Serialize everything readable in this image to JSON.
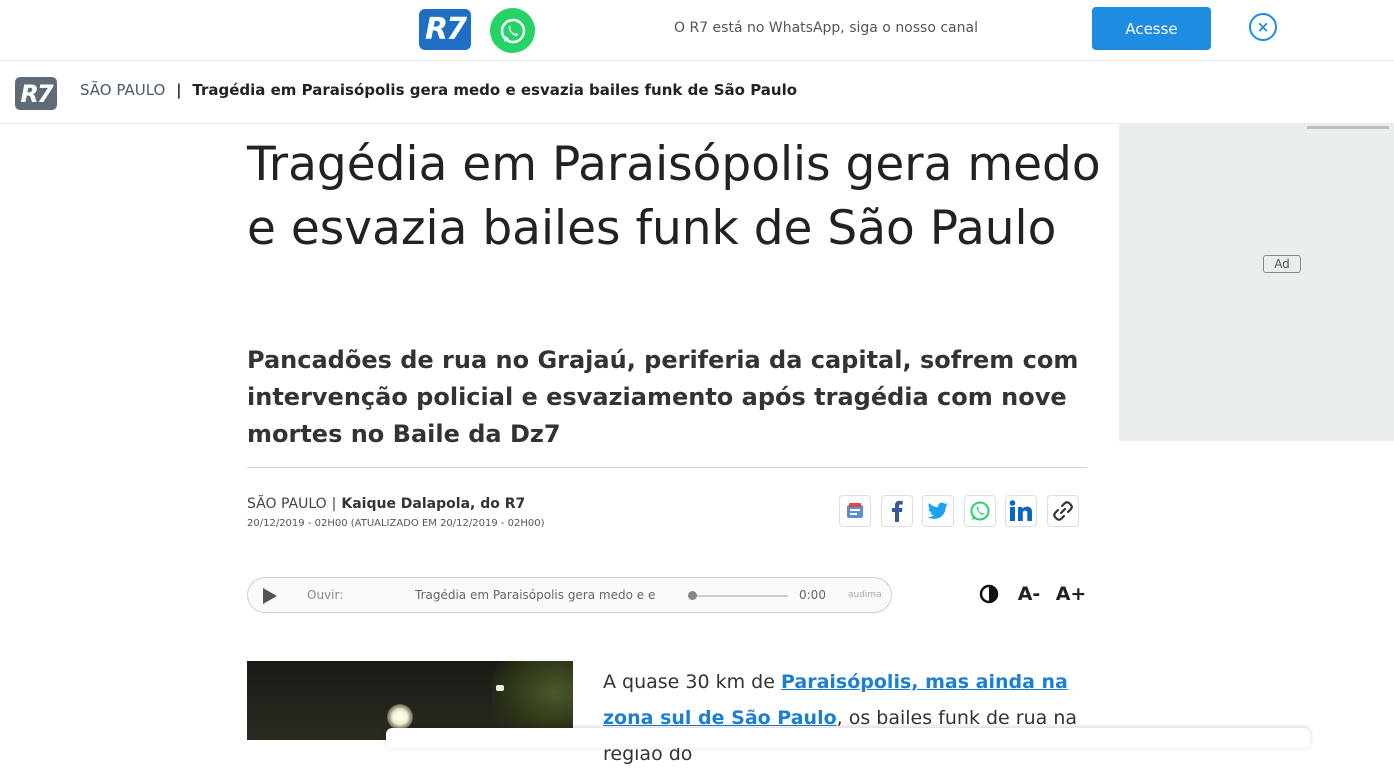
{
  "promo": {
    "logo_text": "R7",
    "whatsapp_icon": "whatsapp-icon",
    "text": "O R7 está no WhatsApp, siga o nosso canal",
    "button_label": "Acesse",
    "close_glyph": "×"
  },
  "nav": {
    "logo_text": "R7",
    "section": "SÃO PAULO",
    "separator": "|",
    "title": "Tragédia em Paraisópolis gera medo e esvazia bailes funk de São Paulo"
  },
  "ad": {
    "label": "Ad"
  },
  "article": {
    "headline": "Tragédia em Paraisópolis gera medo e esvazia bailes funk de São Paulo",
    "subtitle": "Pancadões de rua no Grajaú, periferia da capital, sofrem com intervenção policial e esvaziamento após tragédia com nove mortes no Baile da Dz7",
    "byline_section": "SÃO PAULO",
    "byline_sep": "|",
    "author": "Kaique Dalapola, do R7",
    "date": "20/12/2019 - 02H00 (ATUALIZADO EM 20/12/2019 - 02H00)",
    "share_icons": [
      "google-news-icon",
      "facebook-icon",
      "twitter-icon",
      "whatsapp-icon",
      "linkedin-icon",
      "copy-link-icon"
    ],
    "body_start": "A quase 30 km de ",
    "body_link": "Paraisópolis, mas ainda na zona sul de São Paulo",
    "body_rest": ", os bailes funk de rua na região do"
  },
  "player": {
    "listen_label": "Ouvir:",
    "track_title": "Tragédia em Paraisópolis gera medo e e",
    "time": "0:00",
    "brand": "audima"
  },
  "accessibility": {
    "decrease_label": "A-",
    "increase_label": "A+"
  },
  "colors": {
    "brand_blue": "#1e6fc4",
    "button_blue": "#1e8ce0",
    "whatsapp_green": "#25d366",
    "link_blue": "#1e7fd0"
  }
}
